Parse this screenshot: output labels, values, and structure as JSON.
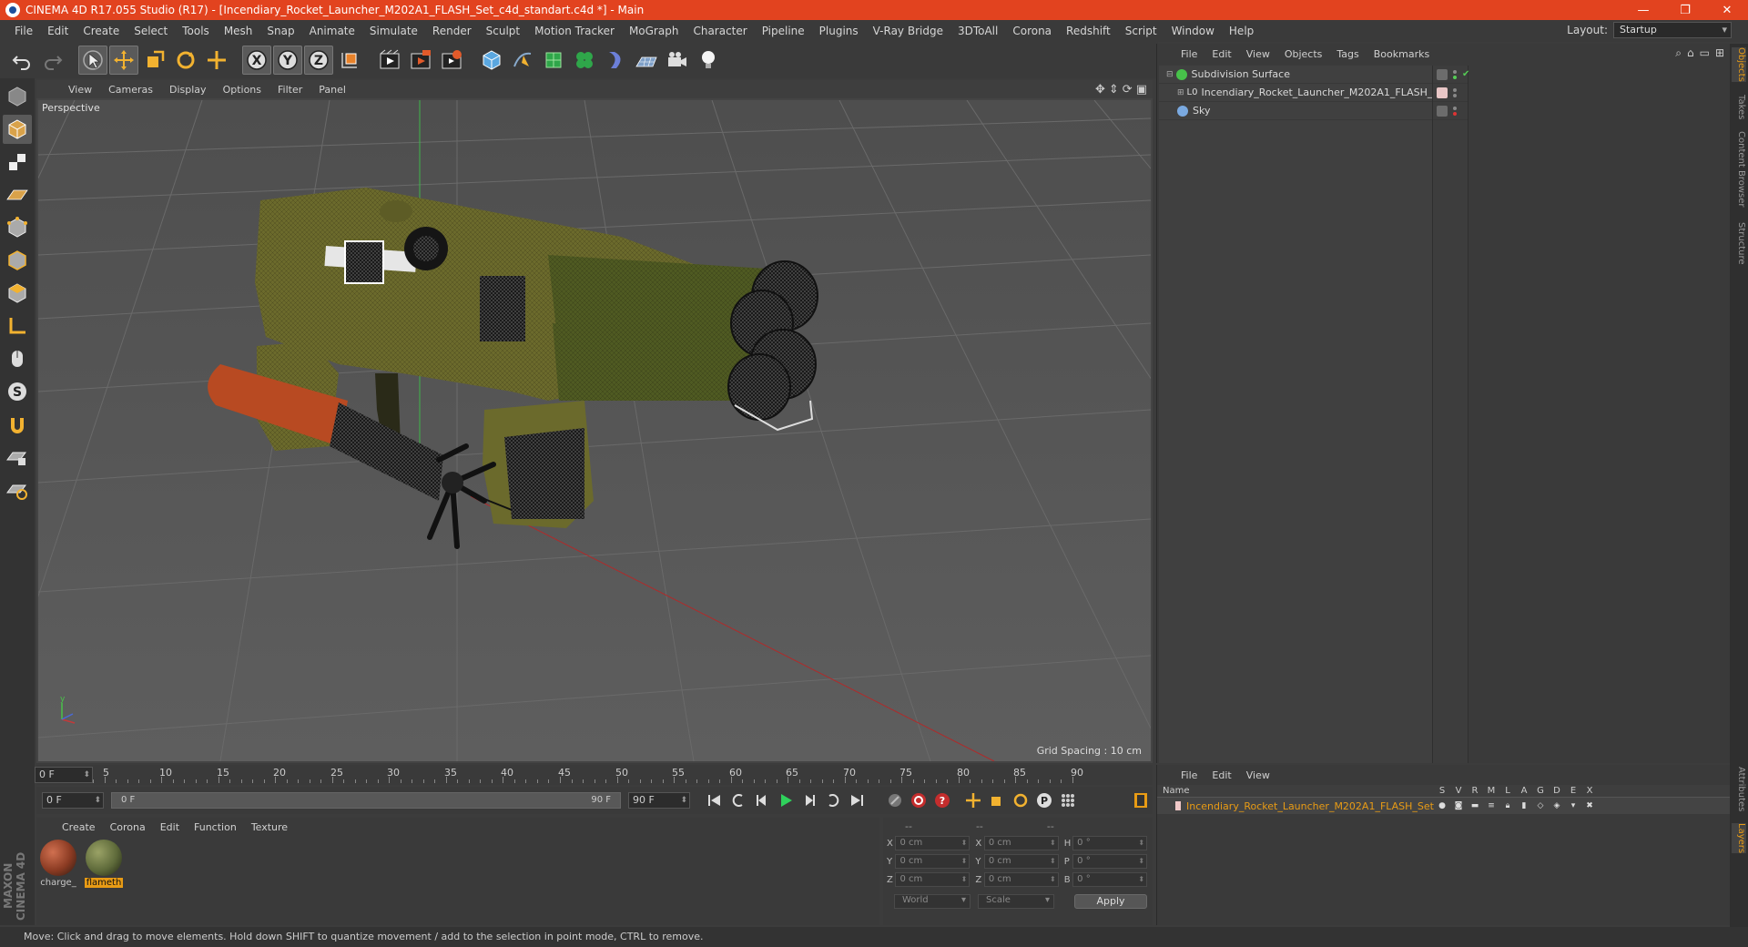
{
  "window": {
    "title": "CINEMA 4D R17.055 Studio (R17) - [Incendiary_Rocket_Launcher_M202A1_FLASH_Set_c4d_standart.c4d *] - Main",
    "controls": [
      "—",
      "❐",
      "✕"
    ]
  },
  "menubar": {
    "items": [
      "File",
      "Edit",
      "Create",
      "Select",
      "Tools",
      "Mesh",
      "Snap",
      "Animate",
      "Simulate",
      "Render",
      "Sculpt",
      "Motion Tracker",
      "MoGraph",
      "Character",
      "Pipeline",
      "Plugins",
      "V-Ray Bridge",
      "3DToAll",
      "Corona",
      "Redshift",
      "Script",
      "Window",
      "Help"
    ],
    "layout_label": "Layout:",
    "layout_value": "Startup"
  },
  "toolbar": {
    "icons": [
      "undo-icon",
      "redo-icon",
      "live-selection-icon",
      "move-icon",
      "scale-icon",
      "rotate-icon",
      "recent-tool-icon",
      "x-axis-icon",
      "y-axis-icon",
      "z-axis-icon",
      "coordinate-system-icon",
      "render-view-icon",
      "render-picture-viewer-icon",
      "render-settings-icon",
      "cube-icon",
      "pen-icon",
      "subdivision-icon",
      "cloner-icon",
      "deformer-icon",
      "floor-icon",
      "camera-icon",
      "light-icon"
    ],
    "axis_labels": [
      "X",
      "Y",
      "Z"
    ]
  },
  "viewport": {
    "menu": [
      "View",
      "Cameras",
      "Display",
      "Options",
      "Filter",
      "Panel"
    ],
    "label": "Perspective",
    "grid_spacing": "Grid Spacing : 10 cm"
  },
  "timeline": {
    "ticks": [
      "0",
      "5",
      "10",
      "15",
      "20",
      "25",
      "30",
      "35",
      "40",
      "45",
      "50",
      "55",
      "60",
      "65",
      "70",
      "75",
      "80",
      "85",
      "90"
    ],
    "current_frame": "0 F",
    "start_field": "0 F",
    "range_start": "0 F",
    "range_end": "90 F",
    "end_field": "90 F"
  },
  "material_manager": {
    "menu": [
      "Create",
      "Corona",
      "Edit",
      "Function",
      "Texture"
    ],
    "materials": [
      {
        "name": "charge_",
        "selected": false,
        "color": "#8a3a22"
      },
      {
        "name": "flameth",
        "selected": true,
        "color": "#5e6a3a"
      }
    ]
  },
  "coordinates": {
    "headers": [
      "--",
      "--",
      "--"
    ],
    "rows": [
      {
        "a": "X",
        "av": "0 cm",
        "b": "X",
        "bv": "0 cm",
        "c": "H",
        "cv": "0 °"
      },
      {
        "a": "Y",
        "av": "0 cm",
        "b": "Y",
        "bv": "0 cm",
        "c": "P",
        "cv": "0 °"
      },
      {
        "a": "Z",
        "av": "0 cm",
        "b": "Z",
        "bv": "0 cm",
        "c": "B",
        "cv": "0 °"
      }
    ],
    "mode": "World",
    "size_mode": "Scale",
    "apply": "Apply"
  },
  "object_manager": {
    "menu": [
      "File",
      "Edit",
      "View",
      "Objects",
      "Tags",
      "Bookmarks"
    ],
    "objects": [
      {
        "name": "Subdivision Surface",
        "icon_color": "#47c24a",
        "indent": 0
      },
      {
        "name": "Incendiary_Rocket_Launcher_M202A1_FLASH_Set",
        "icon_color": "#d0d0d0",
        "indent": 1
      },
      {
        "name": "Sky",
        "icon_color": "#7aa9e0",
        "indent": 0
      }
    ]
  },
  "layer_manager": {
    "menu": [
      "File",
      "Edit",
      "View"
    ],
    "columns": [
      "Name",
      "S",
      "V",
      "R",
      "M",
      "L",
      "A",
      "G",
      "D",
      "E",
      "X"
    ],
    "layers": [
      {
        "name": "Incendiary_Rocket_Launcher_M202A1_FLASH_Set"
      }
    ]
  },
  "right_tabs": [
    "Objects",
    "Takes",
    "Content Browser",
    "Structure",
    "Attributes",
    "Layers"
  ],
  "logo": {
    "line1": "MAXON",
    "line2": "CINEMA 4D"
  },
  "status": "Move: Click and drag to move elements. Hold down SHIFT to quantize movement / add to the selection in point mode, CTRL to remove.",
  "colors": {
    "accent": "#e89b15",
    "titlebar": "#e2431f",
    "play": "#2fd15c"
  }
}
